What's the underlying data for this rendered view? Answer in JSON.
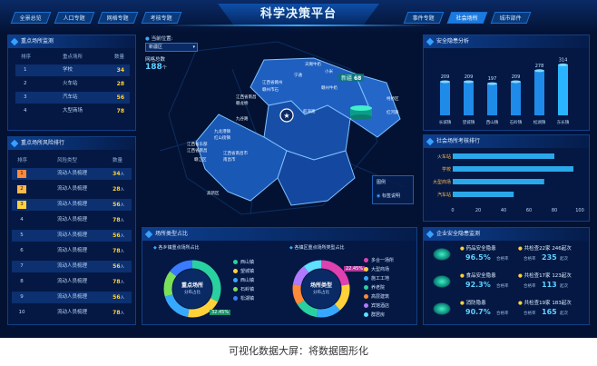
{
  "nav": {
    "left": [
      "全景总览",
      "人口专题",
      "网格专题",
      "考核专题"
    ],
    "right": [
      "事件专题",
      "社会场所",
      "城市部件"
    ],
    "active": "社会场所",
    "title": "科学决策平台"
  },
  "place_monitor": {
    "title": "重点场所监测",
    "headers": [
      "排序",
      "重点场所",
      "数量"
    ],
    "rows": [
      {
        "rank": "1",
        "name": "学校",
        "count": "34"
      },
      {
        "rank": "2",
        "name": "火车站",
        "count": "28"
      },
      {
        "rank": "3",
        "name": "汽车站",
        "count": "56"
      },
      {
        "rank": "4",
        "name": "大型商场",
        "count": "78"
      }
    ]
  },
  "risk_rank": {
    "title": "重点场所风险排行",
    "headers": [
      "排序",
      "风险类型",
      "数量"
    ],
    "unit": "人",
    "rows": [
      {
        "rank": "1",
        "type": "流动人员梳理",
        "count": "34"
      },
      {
        "rank": "2",
        "type": "流动人员梳理",
        "count": "28"
      },
      {
        "rank": "3",
        "type": "流动人员梳理",
        "count": "56"
      },
      {
        "rank": "4",
        "type": "流动人员梳理",
        "count": "78"
      },
      {
        "rank": "5",
        "type": "流动人员梳理",
        "count": "56"
      },
      {
        "rank": "6",
        "type": "流动人员梳理",
        "count": "78"
      },
      {
        "rank": "7",
        "type": "流动人员梳理",
        "count": "56"
      },
      {
        "rank": "8",
        "type": "流动人员梳理",
        "count": "78"
      },
      {
        "rank": "9",
        "type": "流动人员梳理",
        "count": "56"
      },
      {
        "rank": "10",
        "type": "流动人员梳理",
        "count": "78"
      }
    ]
  },
  "map": {
    "location_label": "当前位置:",
    "location_value": "新疆区",
    "grid_total_label": "网格总数",
    "grid_total_value": "188",
    "grid_total_unit": "个",
    "badge_name": "新疆",
    "badge_value": "68",
    "legend_title": "图例",
    "legend_item": "标签说明",
    "regions": [
      "天赐牛奶",
      "小米",
      "宁通",
      "江西省赣州",
      "赣州市石",
      "赣州牛奶",
      "江西省南昌",
      "赣龙桥",
      "航海路",
      "柯桥区",
      "红河路",
      "九龙港镇",
      "红山街镇",
      "九谷路",
      "江西省东部",
      "江西省南昌",
      "赣江区",
      "江西省南昌市",
      "南昌市",
      "高新区"
    ]
  },
  "safety": {
    "title": "安全隐患分析",
    "chart_data": {
      "type": "bar",
      "categories": [
        "长城镇",
        "望城镇",
        "西山镇",
        "石岭镇",
        "松湖镇",
        "东长镇"
      ],
      "values": [
        209,
        209,
        197,
        209,
        278,
        314
      ]
    }
  },
  "social_rank": {
    "title": "社会场所考核排行",
    "chart_data": {
      "type": "bar",
      "orientation": "horizontal",
      "categories": [
        "火车站",
        "学校",
        "大型商场",
        "汽车站"
      ],
      "values": [
        80,
        95,
        72,
        48
      ],
      "xlim": [
        0,
        100
      ],
      "xticks": [
        "0",
        "20",
        "40",
        "60",
        "80",
        "100"
      ]
    }
  },
  "place_type": {
    "title": "场所类型占比",
    "left": {
      "subtitle": "各乡镇重点场所占比",
      "center_title": "重点场所",
      "center_sub": "分布占比",
      "pct_label": "32.45%",
      "chart_data": {
        "type": "pie",
        "labels": [
          "西山镇",
          "望城镇",
          "西山镇",
          "石岭镇",
          "松湖镇"
        ],
        "values": [
          32.45,
          20,
          18,
          15,
          14.55
        ]
      },
      "legend": [
        "西山镇",
        "望城镇",
        "西山镇",
        "石岭镇",
        "松湖镇"
      ]
    },
    "right": {
      "subtitle": "各镇区重点场所类型占比",
      "center_title": "场所类型",
      "center_sub": "分布占比",
      "pct_label": "22.45%",
      "chart_data": {
        "type": "pie",
        "labels": [
          "多合一场所",
          "大型商场",
          "施工工地",
          "养老院",
          "高层建筑",
          "宾馆酒店",
          "群居房"
        ],
        "values": [
          22.45,
          16,
          14,
          13,
          12,
          12,
          10.55
        ]
      },
      "legend": [
        "多合一场所",
        "大型商场",
        "施工工地",
        "养老院",
        "高层建筑",
        "宾馆酒店",
        "群居房"
      ]
    }
  },
  "enterprise": {
    "title": "企业安全隐患监测",
    "rows": [
      {
        "name": "药品安全隐患",
        "pct": "96.5%",
        "pct_label": "合格率",
        "total": "共检查22家",
        "issues": "246起次",
        "qualified_label": "合格率",
        "qualified": "235",
        "unit": "起次"
      },
      {
        "name": "食品安全隐患",
        "pct": "92.3%",
        "pct_label": "合格率",
        "total": "共检查17家",
        "issues": "123起次",
        "qualified_label": "合格率",
        "qualified": "113",
        "unit": "起次"
      },
      {
        "name": "消防隐患",
        "pct": "90.7%",
        "pct_label": "合格率",
        "total": "共检查19家",
        "issues": "183起次",
        "qualified_label": "合格率",
        "qualified": "165",
        "unit": "起次"
      }
    ]
  },
  "caption": "可视化数据大屏：将数据图形化",
  "colors": {
    "accent": "#36a9ff",
    "value": "#ffd23a",
    "bg": "#031233"
  }
}
